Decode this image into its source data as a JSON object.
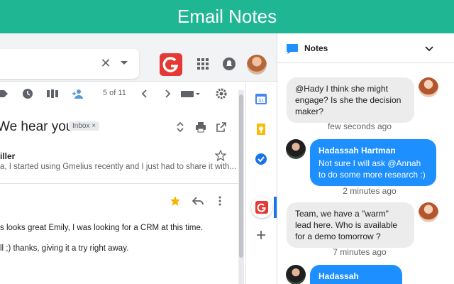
{
  "banner": {
    "title": "Email Notes"
  },
  "toolbar": {
    "pager": "5 of 11"
  },
  "email": {
    "subject": "We hear you",
    "label_chip": "Inbox ×",
    "sender": "iller",
    "snippet": "a, I started using Gmelius recently and I just had to share it with...",
    "body_line1": "s looks great Emily, I was looking for a CRM at this time.",
    "body_line2": "ll ;) thanks, giving it a try right away."
  },
  "notes": {
    "title": "Notes",
    "messages": [
      {
        "author": "",
        "text": "@Hady I think she might engage? Is she the decision maker?",
        "time": "few seconds ago"
      },
      {
        "author": "Hadassah Hartman",
        "text": "Not sure I will ask @Annah to do some more research :)",
        "time": "2 minutes ago"
      },
      {
        "author": "",
        "text": "Team, we have a \"warm\" lead here. Who is available for a demo tomorrow ?",
        "time": "7 minutes ago"
      },
      {
        "author": "Hadassah Hartman",
        "text": "",
        "time": ""
      }
    ]
  },
  "icons": {
    "search_clear": "close-icon",
    "apps": "apps-grid-icon",
    "notifications": "bell-icon"
  },
  "colors": {
    "banner": "#1fb694",
    "outgoing_bubble": "#1e8fff",
    "incoming_bubble": "#ececec",
    "gmelius_red": "#e53935"
  }
}
